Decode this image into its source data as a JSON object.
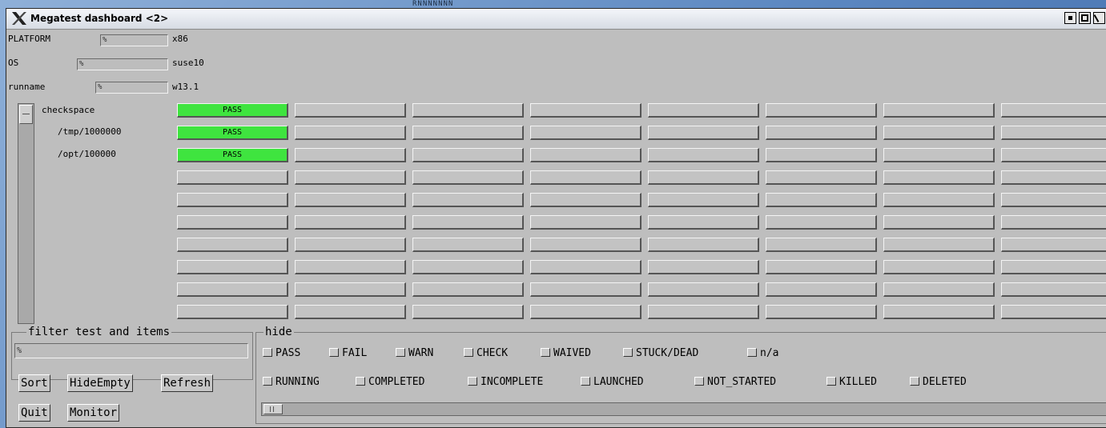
{
  "desktop": {
    "background_text": "RNNNNNNN"
  },
  "window": {
    "title": "Megatest dashboard <2>",
    "controls": [
      "minimize-icon",
      "maximize-icon",
      "close-icon"
    ]
  },
  "fields": [
    {
      "label": "PLATFORM",
      "input_value": "%",
      "value": "x86"
    },
    {
      "label": "OS",
      "input_value": "%",
      "value": "suse10"
    },
    {
      "label": "runname",
      "input_value": "%",
      "value": "w13.1"
    }
  ],
  "tests": [
    {
      "label": "checkspace",
      "status": "PASS"
    },
    {
      "label": "/tmp/1000000",
      "status": "PASS"
    },
    {
      "label": "/opt/100000",
      "status": "PASS"
    }
  ],
  "filter": {
    "title": "filter test and items",
    "input_value": "%"
  },
  "buttons": {
    "sort": "Sort",
    "hide_empty": "HideEmpty",
    "refresh": "Refresh",
    "quit": "Quit",
    "monitor": "Monitor"
  },
  "hide": {
    "title": "hide",
    "row1": [
      "PASS",
      "FAIL",
      "WARN",
      "CHECK",
      "WAIVED",
      "STUCK/DEAD",
      "n/a"
    ],
    "row2": [
      "RUNNING",
      "COMPLETED",
      "INCOMPLETE",
      "LAUNCHED",
      "NOT_STARTED",
      "KILLED",
      "DELETED"
    ]
  },
  "colors": {
    "pass": "#3fe43f",
    "panel": "#bebebe"
  }
}
